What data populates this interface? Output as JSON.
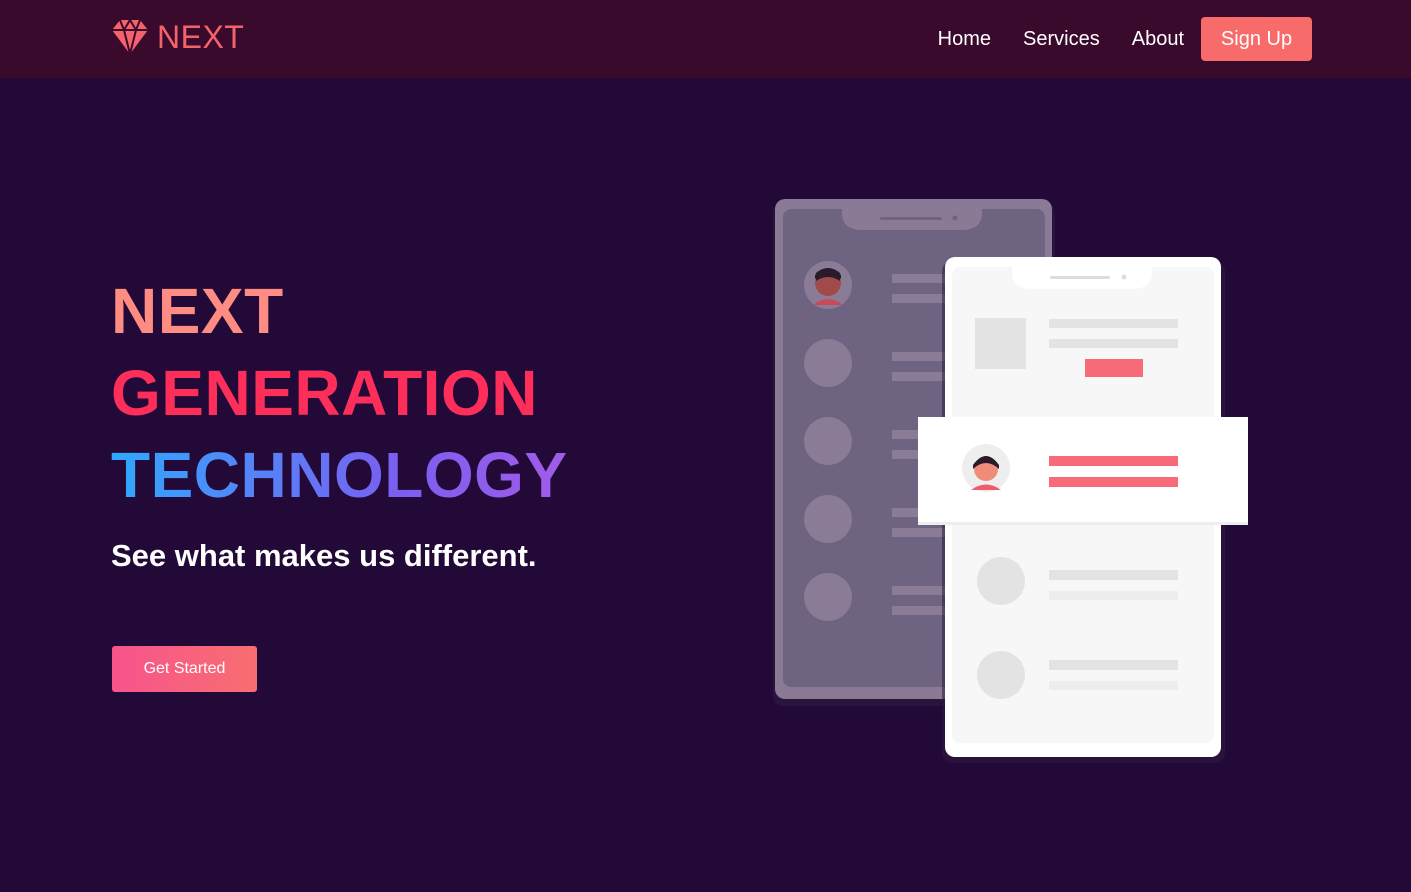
{
  "brand": {
    "name": "NEXT",
    "color": "#f4626b"
  },
  "nav": {
    "links": [
      "Home",
      "Services",
      "About"
    ],
    "signup_label": "Sign Up"
  },
  "hero": {
    "line1": "NEXT",
    "line2": "GENERATION",
    "line3": "TECHNOLOGY",
    "subtitle": "See what makes us different.",
    "cta_label": "Get Started"
  },
  "colors": {
    "background": "#230937",
    "navbar": "#3a0a2d",
    "accent": "#f76b6b",
    "line1": "#ff8c82",
    "line2": "#fe2e5a"
  },
  "illustration": {
    "name": "phone-mockups-illustration"
  }
}
